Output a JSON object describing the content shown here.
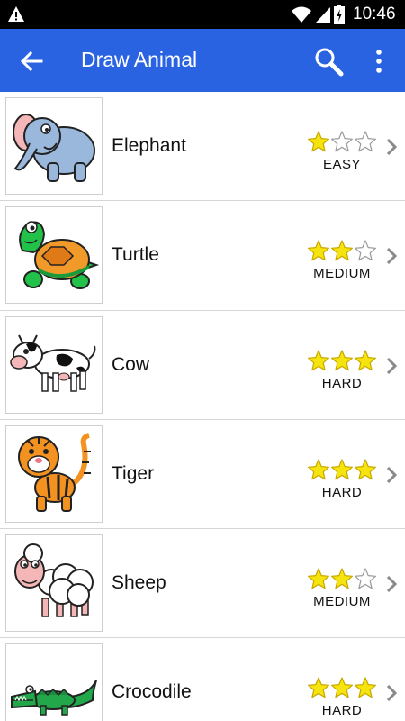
{
  "status_bar": {
    "time": "10:46",
    "icons": [
      "warning-icon",
      "wifi-icon",
      "signal-icon",
      "battery-charging-icon"
    ]
  },
  "app_bar": {
    "title": "Draw Animal",
    "icons": [
      "back-arrow-icon",
      "search-icon",
      "more-vert-icon"
    ]
  },
  "colors": {
    "app_bar": "#2a63e2",
    "star_fill": "#f6e40e",
    "star_stroke": "#c8a800",
    "chevron": "#8a8a8a"
  },
  "animals": [
    {
      "name": "Elephant",
      "rating": 1,
      "max_rating": 3,
      "difficulty": "EASY"
    },
    {
      "name": "Turtle",
      "rating": 2,
      "max_rating": 3,
      "difficulty": "MEDIUM"
    },
    {
      "name": "Cow",
      "rating": 3,
      "max_rating": 3,
      "difficulty": "HARD"
    },
    {
      "name": "Tiger",
      "rating": 3,
      "max_rating": 3,
      "difficulty": "HARD"
    },
    {
      "name": "Sheep",
      "rating": 2,
      "max_rating": 3,
      "difficulty": "MEDIUM"
    },
    {
      "name": "Crocodile",
      "rating": 3,
      "max_rating": 3,
      "difficulty": "HARD"
    }
  ]
}
